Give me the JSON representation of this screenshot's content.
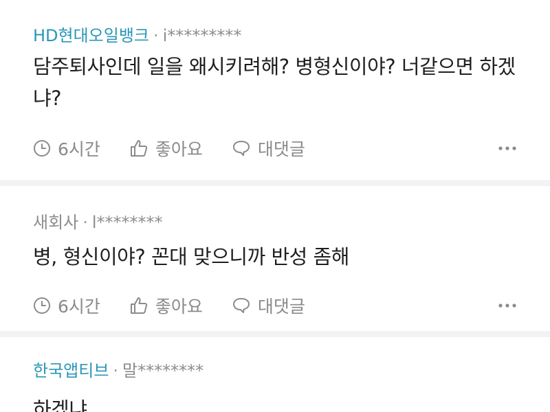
{
  "comments": [
    {
      "company": "HD현대오일뱅크",
      "separator": "·",
      "user": "i*********",
      "text": "담주퇴사인데 일을 왜시키려해? 병형신이야? 너같으면 하겠냐?",
      "time": "6시간",
      "like_label": "좋아요",
      "reply_label": "대댓글"
    },
    {
      "company": "새회사",
      "separator": "·",
      "user": "l********",
      "text": "병, 형신이야? 꼰대 맞으니까 반성 좀해",
      "time": "6시간",
      "like_label": "좋아요",
      "reply_label": "대댓글"
    },
    {
      "company": "한국앱티브",
      "separator": "·",
      "user": "말********",
      "text": "하겠냐"
    }
  ],
  "colors": {
    "company_link": "#2a96b7",
    "meta_gray": "#8c8c8c",
    "divider": "#f3f3f5"
  },
  "icons": [
    "clock-icon",
    "thumbs-up-icon",
    "speech-bubble-icon",
    "more-dots-icon"
  ]
}
